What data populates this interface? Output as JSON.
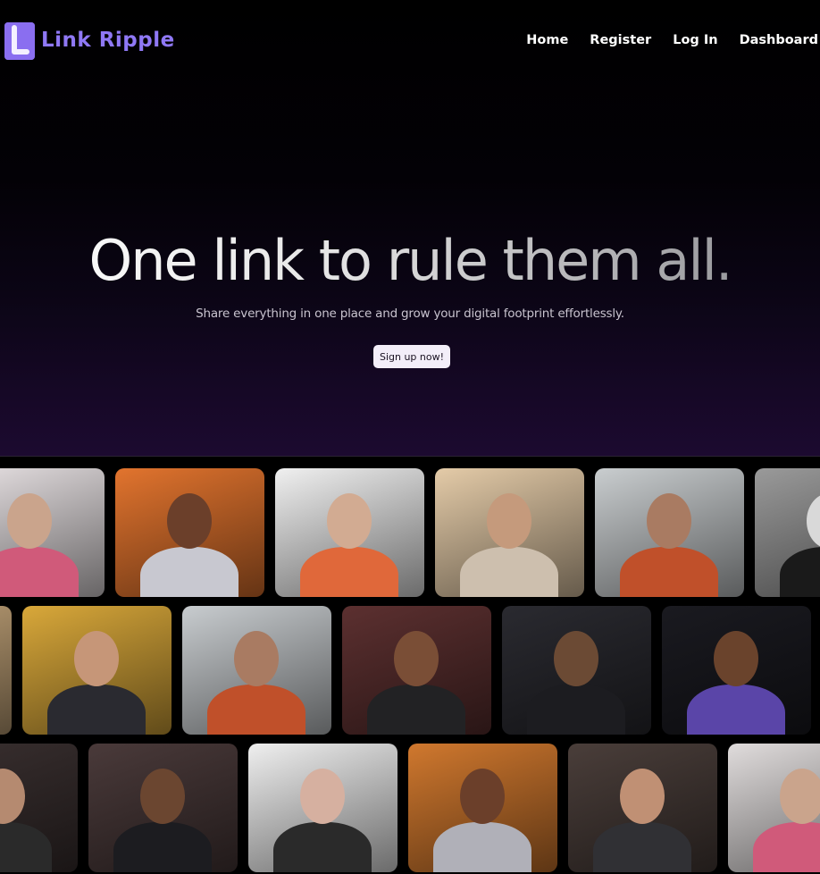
{
  "brand": {
    "name": "Link Ripple"
  },
  "nav": {
    "items": [
      {
        "label": "Home"
      },
      {
        "label": "Register"
      },
      {
        "label": "Log In"
      },
      {
        "label": "Dashboard"
      }
    ]
  },
  "hero": {
    "headline": "One link to rule them all.",
    "subline": "Share everything in one place and grow your digital footprint effortlessly.",
    "cta_label": "Sign up now!"
  },
  "colors": {
    "brand_purple": "#8a6ef0",
    "background": "#000000",
    "hero_glow": "#1c0a30"
  },
  "gallery": {
    "rows": [
      [
        {
          "bg": "#e8e2e4",
          "head": "#caa48c",
          "body": "#d05a7a"
        },
        {
          "bg": "#e2742e",
          "head": "#6b3f2a",
          "body": "#c8c8d0"
        },
        {
          "bg": "#f0f0f0",
          "head": "#d2ab92",
          "body": "#e0683a"
        },
        {
          "bg": "#e4cba8",
          "head": "#c59a7c",
          "body": "#cdbfae"
        },
        {
          "bg": "#c9cdcf",
          "head": "#a97b62",
          "body": "#c0502a"
        },
        {
          "bg": "#9a9a9a",
          "head": "#d9d9d9",
          "body": "#1a1a1a"
        }
      ],
      [
        {
          "bg": "#c4a57a",
          "head": "#caa28a",
          "body": "#3a2a20"
        },
        {
          "bg": "#d9a83a",
          "head": "#c69678",
          "body": "#2a2a30"
        },
        {
          "bg": "#c8cccf",
          "head": "#a97b62",
          "body": "#c0502a"
        },
        {
          "bg": "#5c3030",
          "head": "#7a4e36",
          "body": "#222224"
        },
        {
          "bg": "#2a2a30",
          "head": "#6b4a34",
          "body": "#1c1c20"
        },
        {
          "bg": "#1a1a20",
          "head": "#6a432c",
          "body": "#5a45a8"
        }
      ],
      [
        {
          "bg": "#3a3030",
          "head": "#b58a70",
          "body": "#2a2a2a"
        },
        {
          "bg": "#4a3a3a",
          "head": "#6b4630",
          "body": "#1c1c20"
        },
        {
          "bg": "#efefef",
          "head": "#d6b0a0",
          "body": "#2a2a2a"
        },
        {
          "bg": "#d0782e",
          "head": "#6b3f2a",
          "body": "#b0b0b8"
        },
        {
          "bg": "#4a3e3a",
          "head": "#c09074",
          "body": "#303034"
        },
        {
          "bg": "#e0dcdc",
          "head": "#caa48c",
          "body": "#d05a7a"
        }
      ]
    ]
  }
}
